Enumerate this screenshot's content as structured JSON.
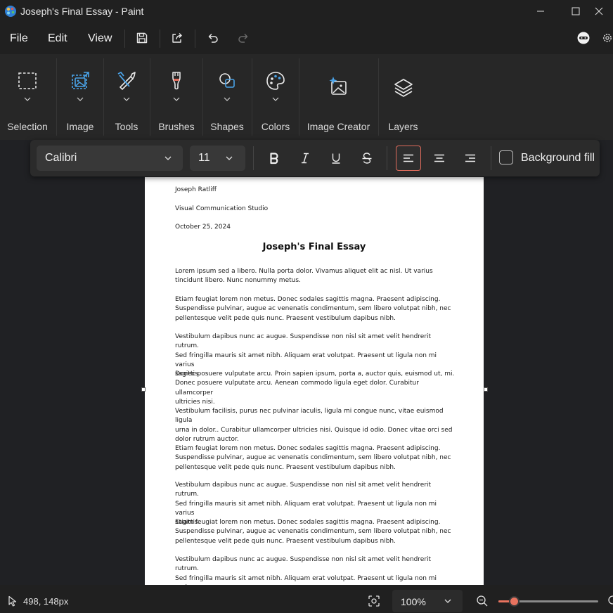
{
  "window": {
    "title": "Joseph's Final Essay - Paint",
    "icons": [
      "paint-app-icon",
      "minimize-icon",
      "maximize-icon",
      "close-icon"
    ]
  },
  "menu": {
    "file": "File",
    "edit": "Edit",
    "view": "View",
    "icons": [
      "save-icon",
      "share-icon",
      "undo-icon",
      "redo-icon",
      "copilot-icon",
      "settings-icon"
    ]
  },
  "ribbon": {
    "selection": "Selection",
    "image": "Image",
    "tools": "Tools",
    "brushes": "Brushes",
    "shapes": "Shapes",
    "colors": "Colors",
    "image_creator": "Image Creator",
    "layers": "Layers"
  },
  "text_toolbar": {
    "font": "Calibri",
    "size": "11",
    "background_fill": "Background fill",
    "background_fill_checked": false,
    "accent_color": "#e06c5c",
    "active_alignment": "align-left"
  },
  "document": {
    "author": "Joseph Ratliff",
    "course": "Visual Communication Studio",
    "date": "October 25, 2024",
    "title": "Joseph's Final Essay",
    "paragraphs": [
      "Lorem ipsum sed a libero. Nulla porta dolor. Vivamus aliquet elit ac nisl. Ut varius\ntincidunt libero. Nunc nonummy metus.",
      "Etiam feugiat lorem non metus. Donec sodales sagittis magna. Praesent adipiscing.\nSuspendisse pulvinar, augue ac venenatis condimentum, sem libero volutpat nibh, nec\npellentesque velit pede quis nunc. Praesent vestibulum dapibus nibh.",
      "Vestibulum dapibus nunc ac augue. Suspendisse non nisl sit amet velit hendrerit rutrum.\nSed fringilla mauris sit amet nibh. Aliquam erat volutpat. Praesent ut ligula non mi varius\nsagittis.",
      "Donec posuere vulputate arcu. Proin sapien ipsum, porta a, auctor quis, euismod ut, mi.\nDonec posuere vulputate arcu. Aenean commodo ligula eget dolor. Curabitur ullamcorper\nultricies nisi.",
      "Vestibulum facilisis, purus nec pulvinar iaculis, ligula mi congue nunc, vitae euismod ligula\nurna in dolor.. Curabitur ullamcorper ultricies nisi. Quisque id odio. Donec vitae orci sed\ndolor rutrum auctor.",
      "Etiam feugiat lorem non metus. Donec sodales sagittis magna. Praesent adipiscing.\nSuspendisse pulvinar, augue ac venenatis condimentum, sem libero volutpat nibh, nec\npellentesque velit pede quis nunc. Praesent vestibulum dapibus nibh.",
      "Vestibulum dapibus nunc ac augue. Suspendisse non nisl sit amet velit hendrerit rutrum.\nSed fringilla mauris sit amet nibh. Aliquam erat volutpat. Praesent ut ligula non mi varius\nsagittis.",
      "Etiam feugiat lorem non metus. Donec sodales sagittis magna. Praesent adipiscing.\nSuspendisse pulvinar, augue ac venenatis condimentum, sem libero volutpat nibh, nec\npellentesque velit pede quis nunc. Praesent vestibulum dapibus nibh.",
      "Vestibulum dapibus nunc ac augue. Suspendisse non nisl sit amet velit hendrerit rutrum.\nSed fringilla mauris sit amet nibh. Aliquam erat volutpat. Praesent ut ligula non mi varius\nsagittis."
    ]
  },
  "status": {
    "coords": "498, 148px",
    "zoom": "100%",
    "zoom_slider_fraction": 0.16
  }
}
